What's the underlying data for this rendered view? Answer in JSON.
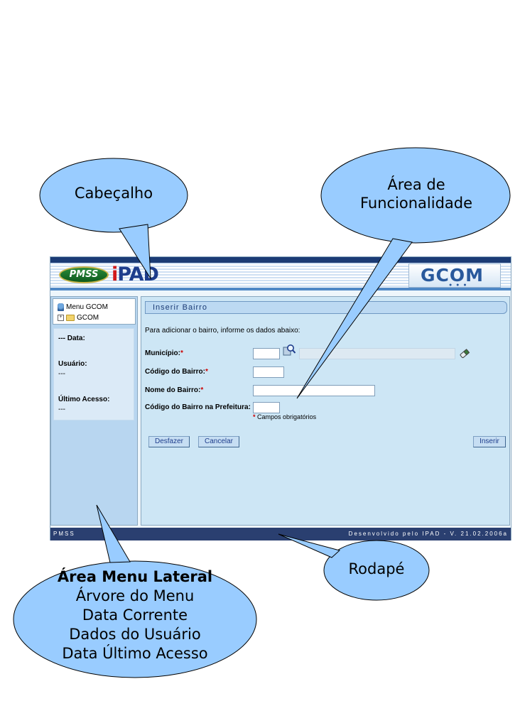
{
  "header": {
    "pmss_logo_text": "PMSS",
    "ipad_logo_text": "PAD",
    "gcom_logo_text": "GCOM"
  },
  "sidebar": {
    "tree": {
      "root_label": "Menu GCOM",
      "expander": "+",
      "folder_label": "GCOM"
    },
    "info": {
      "date_label": "--- Data:",
      "user_label": "Usuário:",
      "user_value": "---",
      "last_access_label": "Último Acesso:",
      "last_access_value": "---"
    }
  },
  "main": {
    "panel_title": "Inserir Bairro",
    "intro_text": "Para adicionar o bairro, informe os dados abaixo:",
    "fields": {
      "municipio_label": "Município:",
      "codigo_label": "Código do Bairro:",
      "nome_label": "Nome do Bairro:",
      "codigo_prefeitura_label": "Código do Bairro na Prefeitura:",
      "required_mark": "*"
    },
    "required_note": "Campos obrigatórios",
    "buttons": {
      "undo": "Desfazer",
      "cancel": "Cancelar",
      "insert": "Inserir"
    }
  },
  "footer": {
    "left_text": "PMSS",
    "right_text": "Desenvolvido pelo IPAD - V. 21.02.2006a"
  },
  "annotations": {
    "header_callout": "Cabeçalho",
    "function_area_callout": [
      "Área de",
      "Funcionalidade"
    ],
    "sidebar_callout": {
      "title": "Área Menu Lateral",
      "lines": [
        "Árvore do Menu",
        "Data Corrente",
        "Dados do Usuário",
        "Data Último Acesso"
      ]
    },
    "footer_callout": "Rodapé"
  },
  "colors": {
    "callout_fill": "#99ccff",
    "header_dark": "#1b3b75",
    "footer_bar": "#2a3f70",
    "main_bg": "#cde6f5",
    "sidebar_bg": "#b8d6f0",
    "required": "#cc0000"
  }
}
